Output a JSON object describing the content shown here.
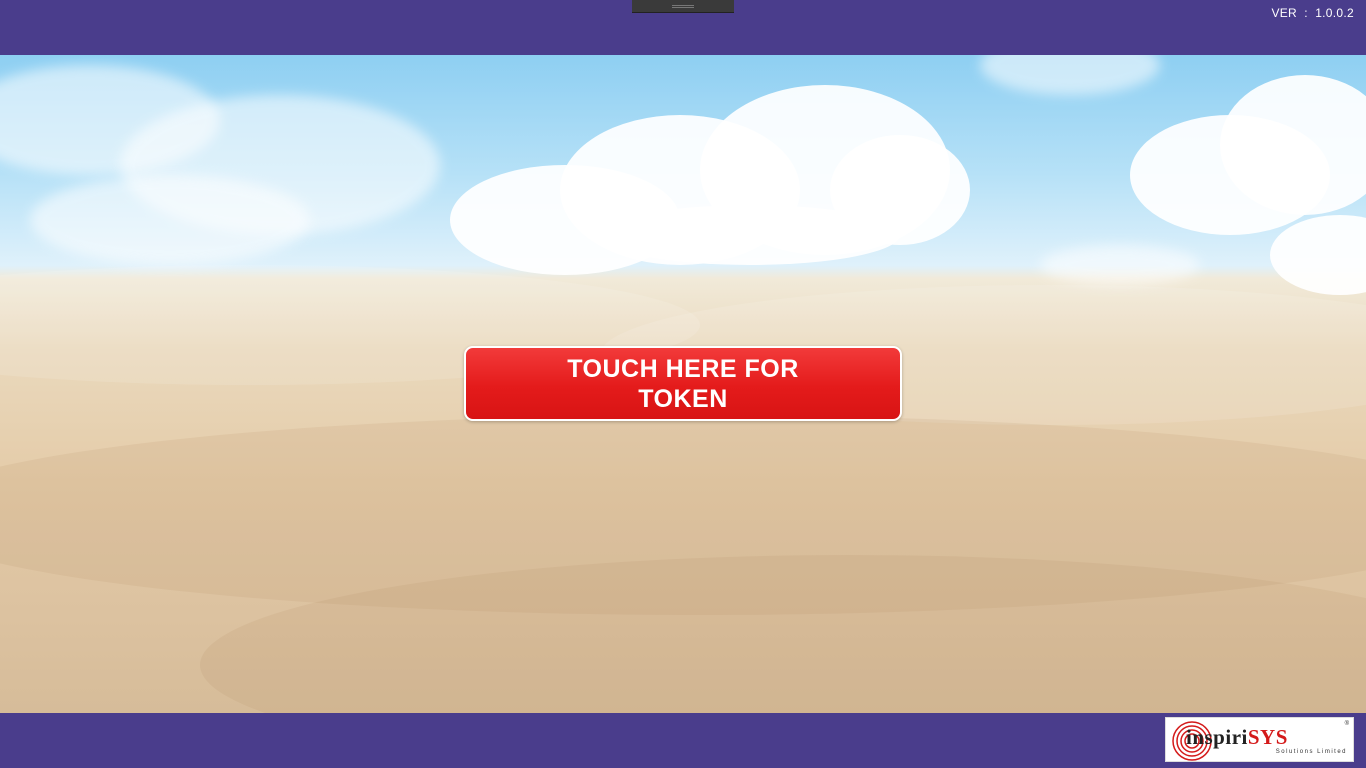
{
  "header": {
    "version_text": "VER  :  1.0.0.2"
  },
  "main": {
    "token_button_label": "TOUCH HERE FOR TOKEN"
  },
  "footer": {
    "logo": {
      "brand_prefix": "inspiri",
      "brand_suffix": "SYS",
      "tagline": "Solutions Limited",
      "trademark": "®"
    }
  },
  "colors": {
    "bar_background": "#4a3d8c",
    "button_red": "#e41b1b",
    "button_text": "#ffffff"
  }
}
